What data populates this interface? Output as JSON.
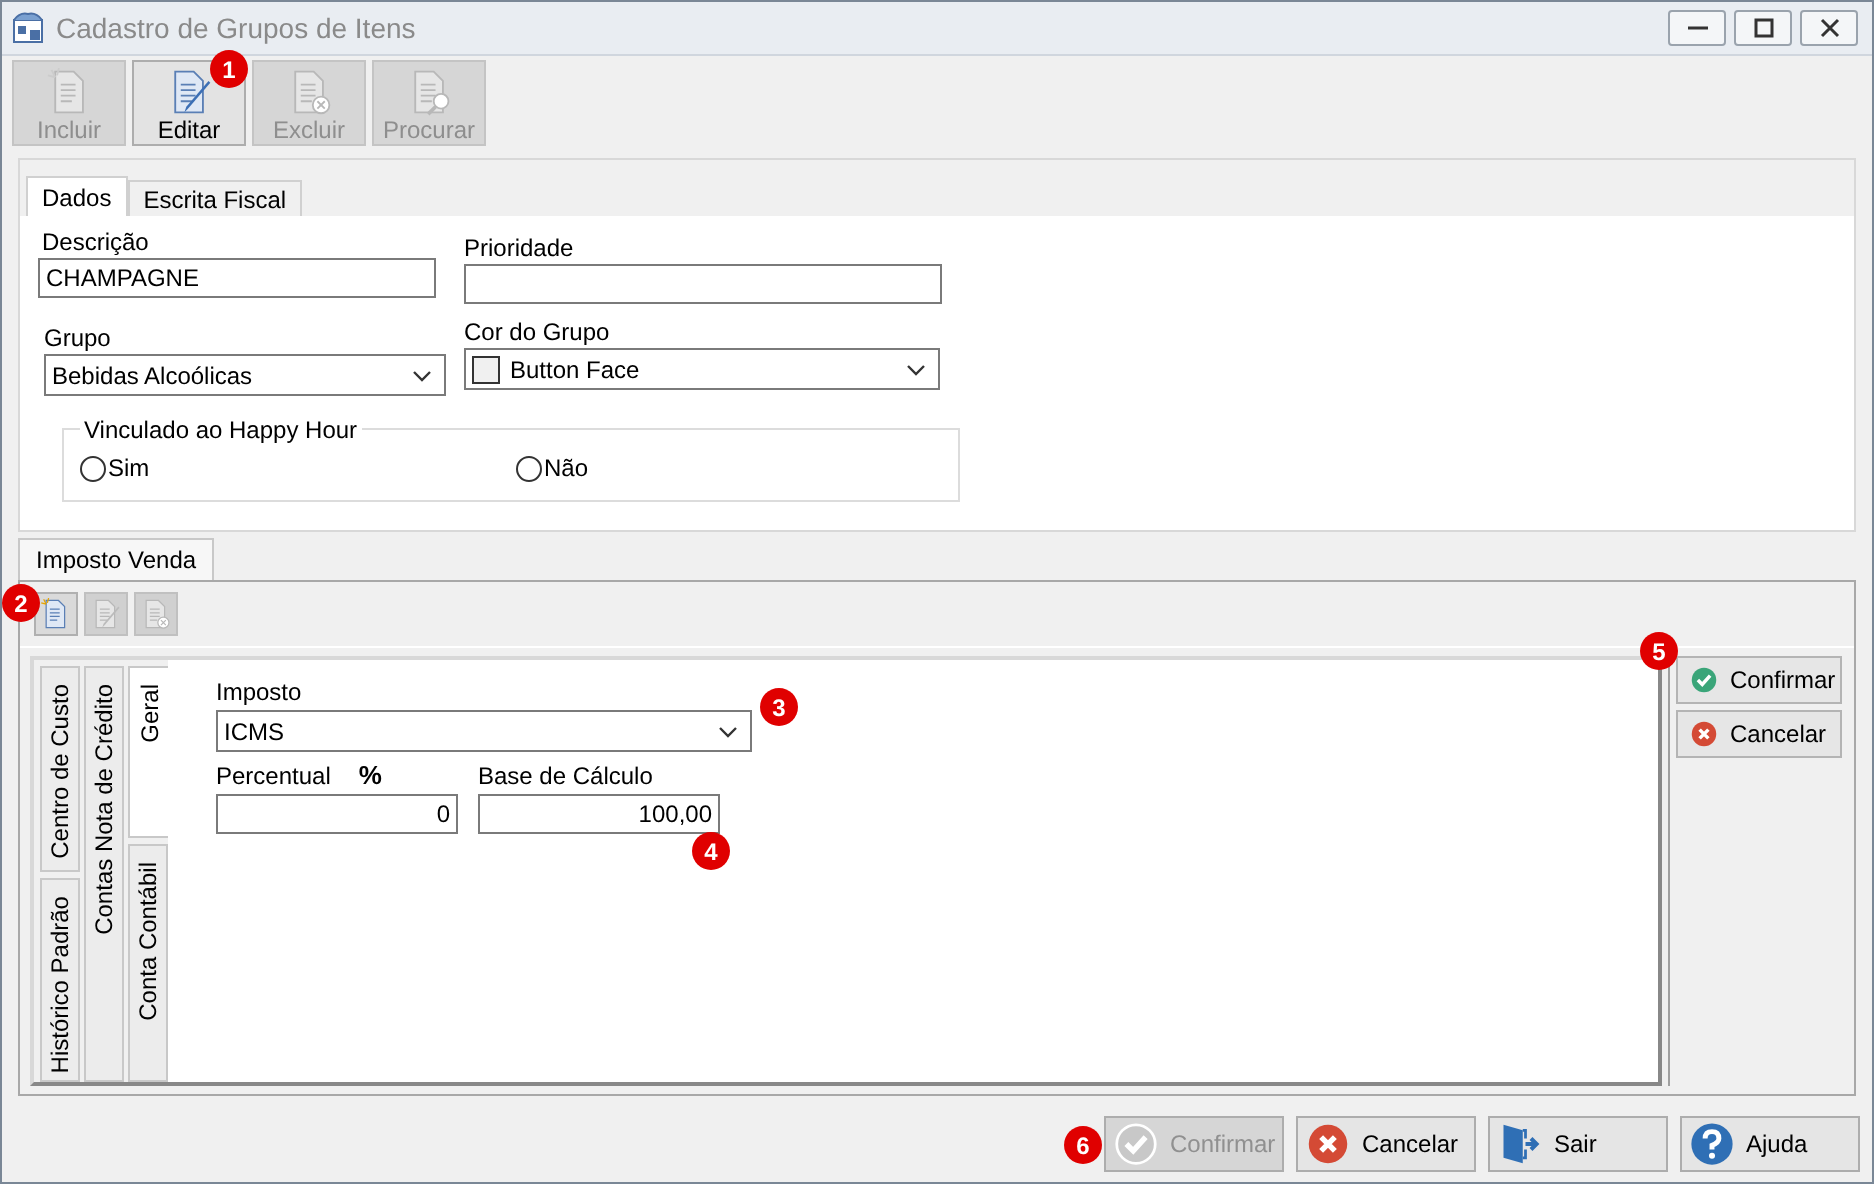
{
  "window": {
    "title": "Cadastro de Grupos de Itens"
  },
  "toolbar": [
    {
      "label": "Incluir",
      "kind": "new",
      "disabled": true
    },
    {
      "label": "Editar",
      "kind": "edit",
      "disabled": false
    },
    {
      "label": "Excluir",
      "kind": "delete",
      "disabled": true
    },
    {
      "label": "Procurar",
      "kind": "search",
      "disabled": true
    }
  ],
  "tabs": [
    {
      "label": "Dados",
      "selected": true
    },
    {
      "label": "Escrita Fiscal",
      "selected": false
    }
  ],
  "form": {
    "descricao": {
      "label": "Descrição",
      "value": "CHAMPAGNE"
    },
    "prioridade": {
      "label": "Prioridade"
    },
    "grupo": {
      "label": "Grupo",
      "value": "Bebidas Alcoólicas"
    },
    "cor_do_grupo": {
      "label": "Cor do Grupo",
      "value": "Button Face",
      "color": "#f0f0f0"
    },
    "happy_hour": {
      "title": "Vinculado ao Happy Hour",
      "options": [
        {
          "label": "Sim",
          "selected": false
        },
        {
          "label": "Não",
          "selected": false
        }
      ]
    }
  },
  "sub_tabs": [
    {
      "label": "Imposto Venda",
      "selected": true
    }
  ],
  "sub_toolbar": [
    {
      "kind": "new",
      "disabled": false
    },
    {
      "kind": "edit",
      "disabled": true
    },
    {
      "kind": "delete",
      "disabled": true
    }
  ],
  "vertical_tabs": [
    {
      "tabs": [
        {
          "label": "Centro de Custo",
          "selected": false
        },
        {
          "label": "Histórico Padrão",
          "selected": false
        }
      ]
    },
    {
      "tabs": [
        {
          "label": "Contas Nota de Crédito",
          "selected": false
        }
      ]
    },
    {
      "tabs": [
        {
          "label": "Geral",
          "selected": true
        },
        {
          "label": "Conta Contábil",
          "selected": false
        }
      ]
    }
  ],
  "geral": {
    "imposto": {
      "label": "Imposto",
      "value": "ICMS"
    },
    "percentual": {
      "label": "Percentual",
      "unit": "%",
      "value": "0"
    },
    "base_de_calculo": {
      "label": "Base de Cálculo",
      "value": "100,00"
    }
  },
  "side_buttons": [
    {
      "label": "Confirmar",
      "kind": "confirm",
      "disabled": false
    },
    {
      "label": "Cancelar",
      "kind": "cancel",
      "disabled": false
    }
  ],
  "footer_buttons": [
    {
      "label": "Confirmar",
      "kind": "confirm",
      "disabled": true
    },
    {
      "label": "Cancelar",
      "kind": "cancel",
      "disabled": false
    },
    {
      "label": "Sair",
      "kind": "exit",
      "disabled": false
    },
    {
      "label": "Ajuda",
      "kind": "help",
      "disabled": false
    }
  ],
  "callouts": [
    "1",
    "2",
    "3",
    "4",
    "5",
    "6"
  ]
}
